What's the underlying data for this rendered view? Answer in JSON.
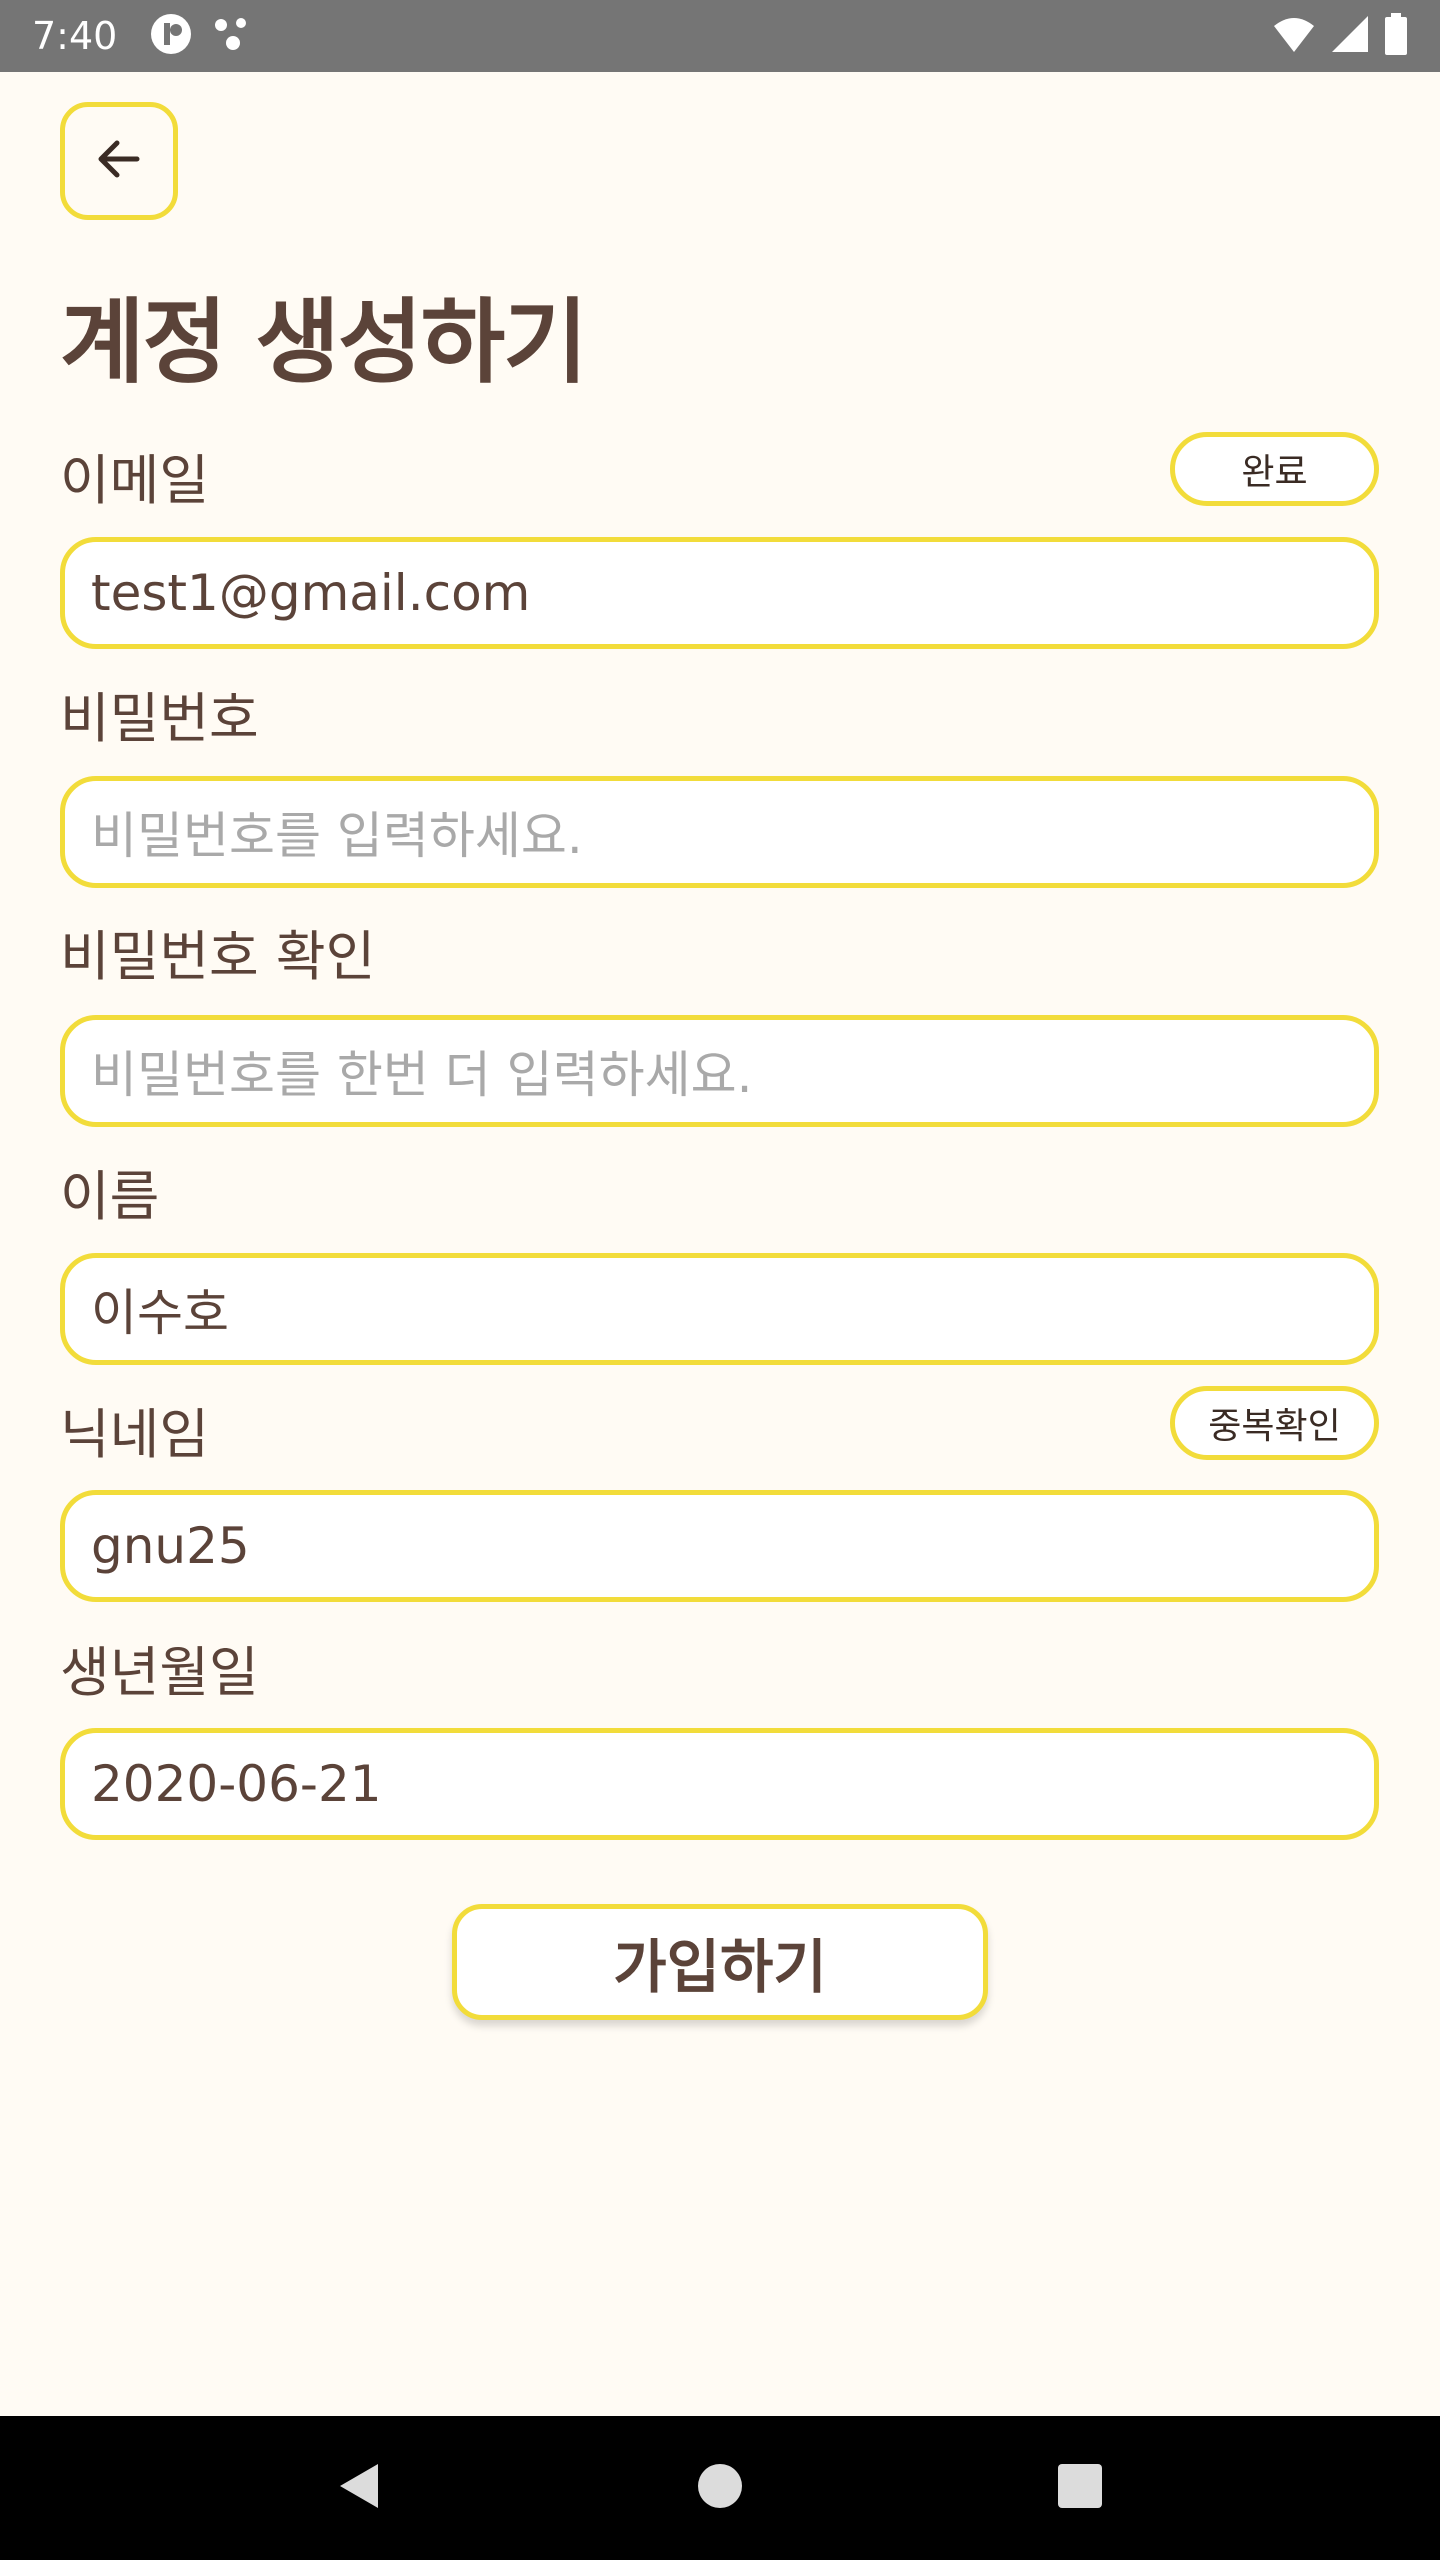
{
  "status_bar": {
    "time": "7:40",
    "icons": [
      "app-notification-icon",
      "dots-icon",
      "wifi-icon",
      "signal-icon",
      "battery-icon"
    ]
  },
  "header": {
    "back_icon": "arrow-left-icon",
    "title": "계정 생성하기"
  },
  "form": {
    "email": {
      "label": "이메일",
      "value": "test1@gmail.com",
      "action_label": "완료"
    },
    "password": {
      "label": "비밀번호",
      "placeholder": "비밀번호를 입력하세요."
    },
    "password_confirm": {
      "label": "비밀번호 확인",
      "placeholder": "비밀번호를 한번 더 입력하세요."
    },
    "name": {
      "label": "이름",
      "value": "이수호"
    },
    "nickname": {
      "label": "닉네임",
      "value": "gnu25",
      "action_label": "중복확인"
    },
    "birthdate": {
      "label": "생년월일",
      "value": "2020-06-21"
    }
  },
  "submit_label": "가입하기",
  "colors": {
    "accent": "#f2dc3a",
    "text": "#5b4339",
    "background": "#fffbf4",
    "placeholder": "#a9a9a9"
  },
  "nav_bar": {
    "icons": [
      "back-triangle-icon",
      "home-circle-icon",
      "recents-square-icon"
    ]
  }
}
